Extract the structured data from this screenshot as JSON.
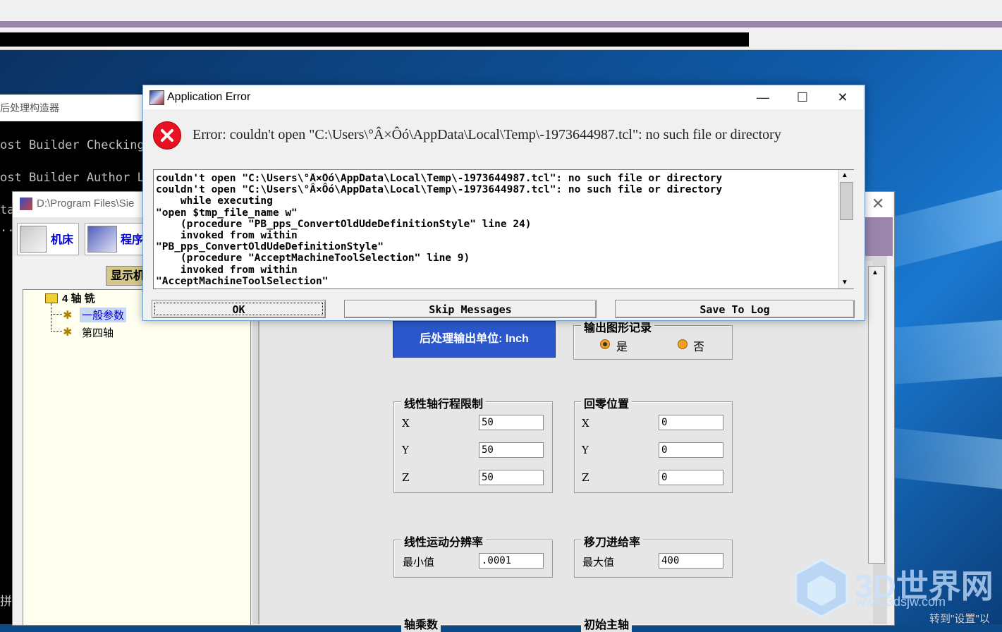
{
  "console": {
    "title": "后处理构造器",
    "lines": [
      "ost Builder Checking",
      "ost Builder Author L",
      "ta",
      "..",
      "拼"
    ]
  },
  "post_builder": {
    "title": "D:\\Program Files\\Sie",
    "toolbar": {
      "machine_label": "机床",
      "program_label": "程序"
    },
    "show_button": "显示机",
    "tree": {
      "root": "4 轴 铣",
      "item_general": "一般参数",
      "item_fourth": "第四轴"
    },
    "unit_button": "后处理输出单位: Inch",
    "graphics_output": {
      "title": "输出图形记录",
      "yes": "是",
      "no": "否",
      "selected": "是"
    },
    "travel_limits": {
      "title": "线性轴行程限制",
      "x_label": "X",
      "y_label": "Y",
      "z_label": "Z",
      "x": "50",
      "y": "50",
      "z": "50"
    },
    "home_position": {
      "title": "回零位置",
      "x_label": "X",
      "y_label": "Y",
      "z_label": "Z",
      "x": "0",
      "y": "0",
      "z": "0"
    },
    "resolution": {
      "title": "线性运动分辨率",
      "min_label": "最小值",
      "min": ".0001"
    },
    "traverse_feed": {
      "title": "移刀进给率",
      "max_label": "最大值",
      "max": "400"
    },
    "bottom_left_title": "轴乘数",
    "bottom_right_title": "初始主轴"
  },
  "dialog": {
    "title": "Application Error",
    "error_message": "Error: couldn't open \"C:\\Users\\°Â×Ôó\\AppData\\Local\\Temp\\-1973644987.tcl\": no such file or directory",
    "details": "couldn't open \"C:\\Users\\°Â×Ôó\\AppData\\Local\\Temp\\-1973644987.tcl\": no such file or directory\ncouldn't open \"C:\\Users\\°Â×Ôó\\AppData\\Local\\Temp\\-1973644987.tcl\": no such file or directory\n    while executing\n\"open $tmp_file_name w\"\n    (procedure \"PB_pps_ConvertOldUdeDefinitionStyle\" line 24)\n    invoked from within\n\"PB_pps_ConvertOldUdeDefinitionStyle\"\n    (procedure \"AcceptMachineToolSelection\" line 9)\n    invoked from within\n\"AcceptMachineToolSelection\"",
    "buttons": {
      "ok": "OK",
      "skip": "Skip Messages",
      "save": "Save To Log"
    }
  },
  "watermark": {
    "brand": "3D世界网",
    "url": "www.3dsjw.com"
  },
  "status_text": "转到\"设置\"以"
}
